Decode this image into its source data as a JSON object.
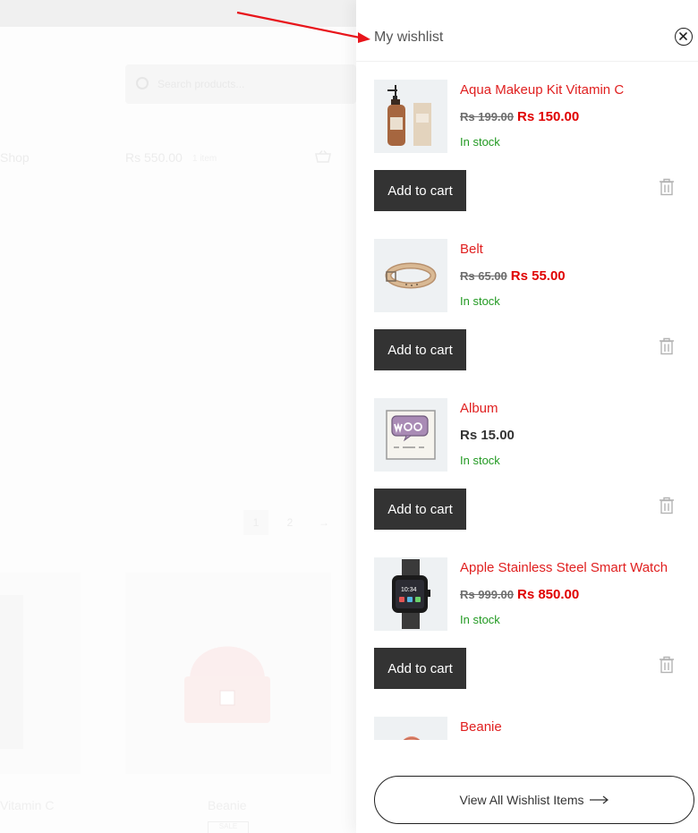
{
  "background_page": {
    "search_placeholder": "Search products...",
    "shop_link": "Shop",
    "cart_amount": "Rs 550.00",
    "cart_count": "1 item",
    "pagination": [
      "1",
      "2",
      "→"
    ],
    "product_titles": [
      "Vitamin C",
      "Beanie"
    ],
    "sale_badge": "SALE"
  },
  "wishlist": {
    "title": "My wishlist",
    "close_icon": "close-circle-icon",
    "add_to_cart_label": "Add to cart",
    "view_all_label": "View All Wishlist Items",
    "view_all_icon": "long-arrow-right-icon",
    "remove_icon": "trash-icon",
    "items": [
      {
        "name": "Aqua Makeup Kit Vitamin C",
        "old_price": "Rs 199.00",
        "price": "Rs 150.00",
        "stock": "In stock"
      },
      {
        "name": "Belt",
        "old_price": "Rs 65.00",
        "price": "Rs 55.00",
        "stock": "In stock"
      },
      {
        "name": "Album",
        "old_price": "",
        "price": "Rs 15.00",
        "stock": "In stock"
      },
      {
        "name": "Apple Stainless Steel Smart Watch",
        "old_price": "Rs 999.00",
        "price": "Rs 850.00",
        "stock": "In stock"
      },
      {
        "name": "Beanie",
        "old_price": "",
        "price": "",
        "stock": ""
      }
    ]
  },
  "colors": {
    "accent_red": "#e02020",
    "sale_price_red": "#e00000",
    "in_stock_green": "#239a23",
    "button_dark": "#333333",
    "annotation_arrow": "#e8151b"
  }
}
